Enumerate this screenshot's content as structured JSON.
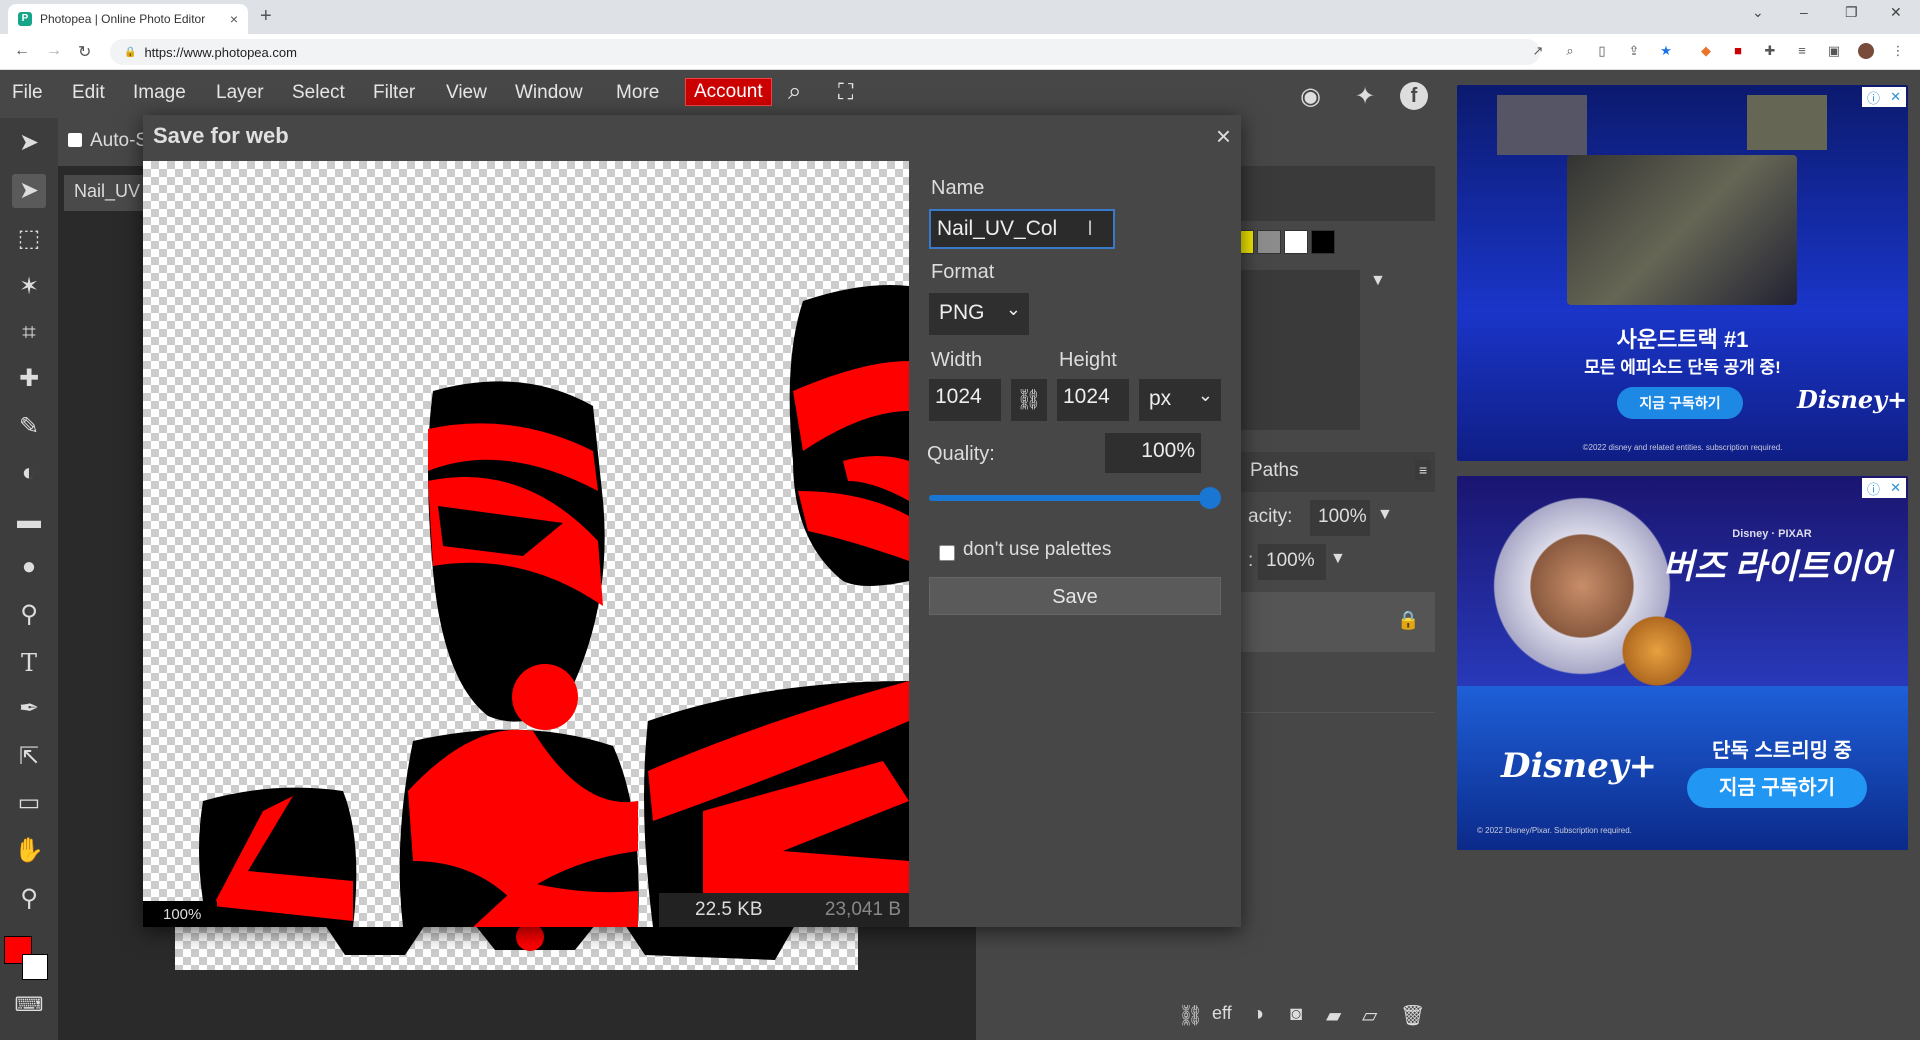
{
  "browser": {
    "tab_title": "Photopea | Online Photo Editor",
    "url": "https://www.photopea.com",
    "new_tab": "+",
    "tab_close": "×"
  },
  "menu": {
    "items": [
      "File",
      "Edit",
      "Image",
      "Layer",
      "Select",
      "Filter",
      "View",
      "Window",
      "More"
    ],
    "account": "Account"
  },
  "options": {
    "auto_select": "Auto-S"
  },
  "document": {
    "tab_label": "Nail_UV"
  },
  "dialog": {
    "title": "Save for web",
    "close": "×",
    "zoom": "100%",
    "size_kb": "22.5 KB",
    "size_bytes": "23,041 B",
    "name_label": "Name",
    "name_value": "Nail_UV_Col",
    "format_label": "Format",
    "format_value": "PNG",
    "width_label": "Width",
    "height_label": "Height",
    "width_value": "1024",
    "height_value": "1024",
    "unit_value": "px",
    "quality_label": "Quality:",
    "quality_value": "100%",
    "quality_level": 1.0,
    "palettes_label": "don't use palettes",
    "save_label": "Save"
  },
  "panels": {
    "paths_tab": "Paths",
    "opacity_label": "acity:",
    "opacity_value": "100%",
    "fill_label": ":",
    "fill_value": "100%",
    "swatches": [
      "#f2e600",
      "#8c8c8c",
      "#ffffff",
      "#000000"
    ]
  },
  "ads": {
    "ad1_line1": "사운드트랙 #1",
    "ad1_line2": "모든 에피소드 단독 공개 중!",
    "ad1_cta": "지금 구독하기",
    "ad1_brand": "Disney+",
    "ad1_fineprint": "©2022 disney and related entities. subscription required.",
    "ad2_studio": "Disney · PIXAR",
    "ad2_title": "버즈 라이트이어",
    "ad2_brand": "Disney+",
    "ad2_line": "단독 스트리밍 중",
    "ad2_cta": "지금 구독하기",
    "ad2_fineprint": "© 2022 Disney/Pixar. Subscription required."
  },
  "colors": {
    "account_bg": "#cc0000",
    "accent": "#1976d2",
    "foreground": "#ff0000",
    "background": "#ffffff"
  }
}
